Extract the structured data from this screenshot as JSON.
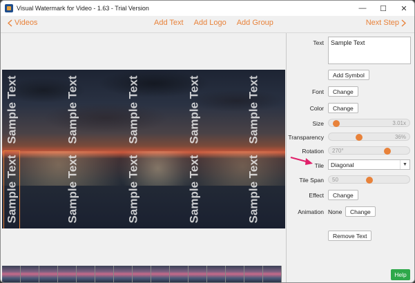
{
  "window": {
    "title": "Visual Watermark for Video - 1.63 - Trial Version"
  },
  "nav": {
    "back_label": "Videos",
    "add_text": "Add Text",
    "add_logo": "Add Logo",
    "add_group": "Add Group",
    "next_label": "Next Step"
  },
  "watermark": {
    "text": "Sample Text"
  },
  "panel": {
    "text_label": "Text",
    "text_value": "Sample Text",
    "add_symbol": "Add Symbol",
    "font_label": "Font",
    "font_button": "Change",
    "color_label": "Color",
    "color_button": "Change",
    "size_label": "Size",
    "size_value": "3.01x",
    "size_level": 0.05,
    "transparency_label": "Transparency",
    "transparency_value": "36%",
    "transparency_level": 0.36,
    "rotation_label": "Rotation",
    "rotation_value": "270°",
    "rotation_level": 0.75,
    "tile_label": "Tile",
    "tile_value": "Diagonal",
    "tile_span_label": "Tile Span",
    "tile_span_value": "50",
    "tile_span_level": 0.5,
    "effect_label": "Effect",
    "effect_button": "Change",
    "animation_label": "Animation",
    "animation_value": "None",
    "animation_button": "Change",
    "remove_text": "Remove Text",
    "help": "Help"
  },
  "colors": {
    "accent": "#e8823a",
    "help": "#2ea84a",
    "annotation_arrow": "#e0206a"
  },
  "icons": {
    "back": "chevron-left-icon",
    "next": "chevron-right-icon",
    "dropdown": "chevron-down-icon"
  }
}
